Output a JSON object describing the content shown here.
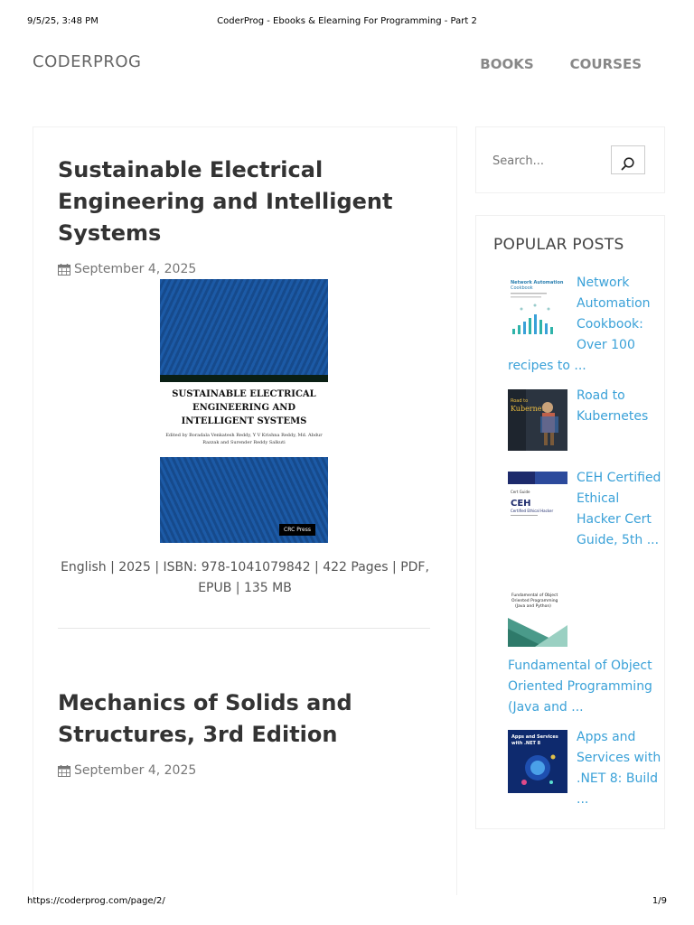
{
  "print": {
    "datetime": "9/5/25, 3:48 PM",
    "doc_title": "CoderProg - Ebooks & Elearning For Programming - Part 2",
    "url": "https://coderprog.com/page/2/",
    "page": "1/9"
  },
  "site": {
    "logo": "CODERPROG",
    "nav": [
      "BOOKS",
      "COURSES"
    ]
  },
  "posts": [
    {
      "title": "Sustainable Electrical Engineering and Intelligent Systems",
      "date": "September 4, 2025",
      "cover": {
        "title": "SUSTAINABLE ELECTRICAL ENGINEERING AND INTELLIGENT SYSTEMS",
        "editors": "Edited by Boradala Venkatesh Reddy, Y V Krishna Reddy, Md. Abdur Razzak and Surender Reddy Salkuti",
        "publisher": "CRC Press"
      },
      "meta": "English | 2025 | ISBN: 978-1041079842 | 422 Pages | PDF, EPUB | 135 MB"
    },
    {
      "title": "Mechanics of Solids and Structures, 3rd Edition",
      "date": "September 4, 2025"
    }
  ],
  "sidebar": {
    "search_placeholder": "Search...",
    "popular_title": "POPULAR POSTS",
    "popular": [
      {
        "title": "Network Automation Cookbook: Over 100 recipes to ...",
        "thumb_text": "Network Automation Cookbook"
      },
      {
        "title": "Road to Kubernetes",
        "thumb_text": "Road to Kubernetes"
      },
      {
        "title": "CEH Certified Ethical Hacker Cert Guide, 5th ...",
        "thumb_text": "CEH"
      },
      {
        "title": "Fundamental of Object Oriented Programming (Java and ...",
        "thumb_text": "Fundamental of Object Oriented Programming (Java and Python)"
      },
      {
        "title": "Apps and Services with .NET 8: Build ...",
        "thumb_text": "Apps and Services with .NET 8"
      }
    ]
  },
  "colors": {
    "link": "#3aa1d8",
    "heading": "#333333",
    "muted": "#777777"
  }
}
